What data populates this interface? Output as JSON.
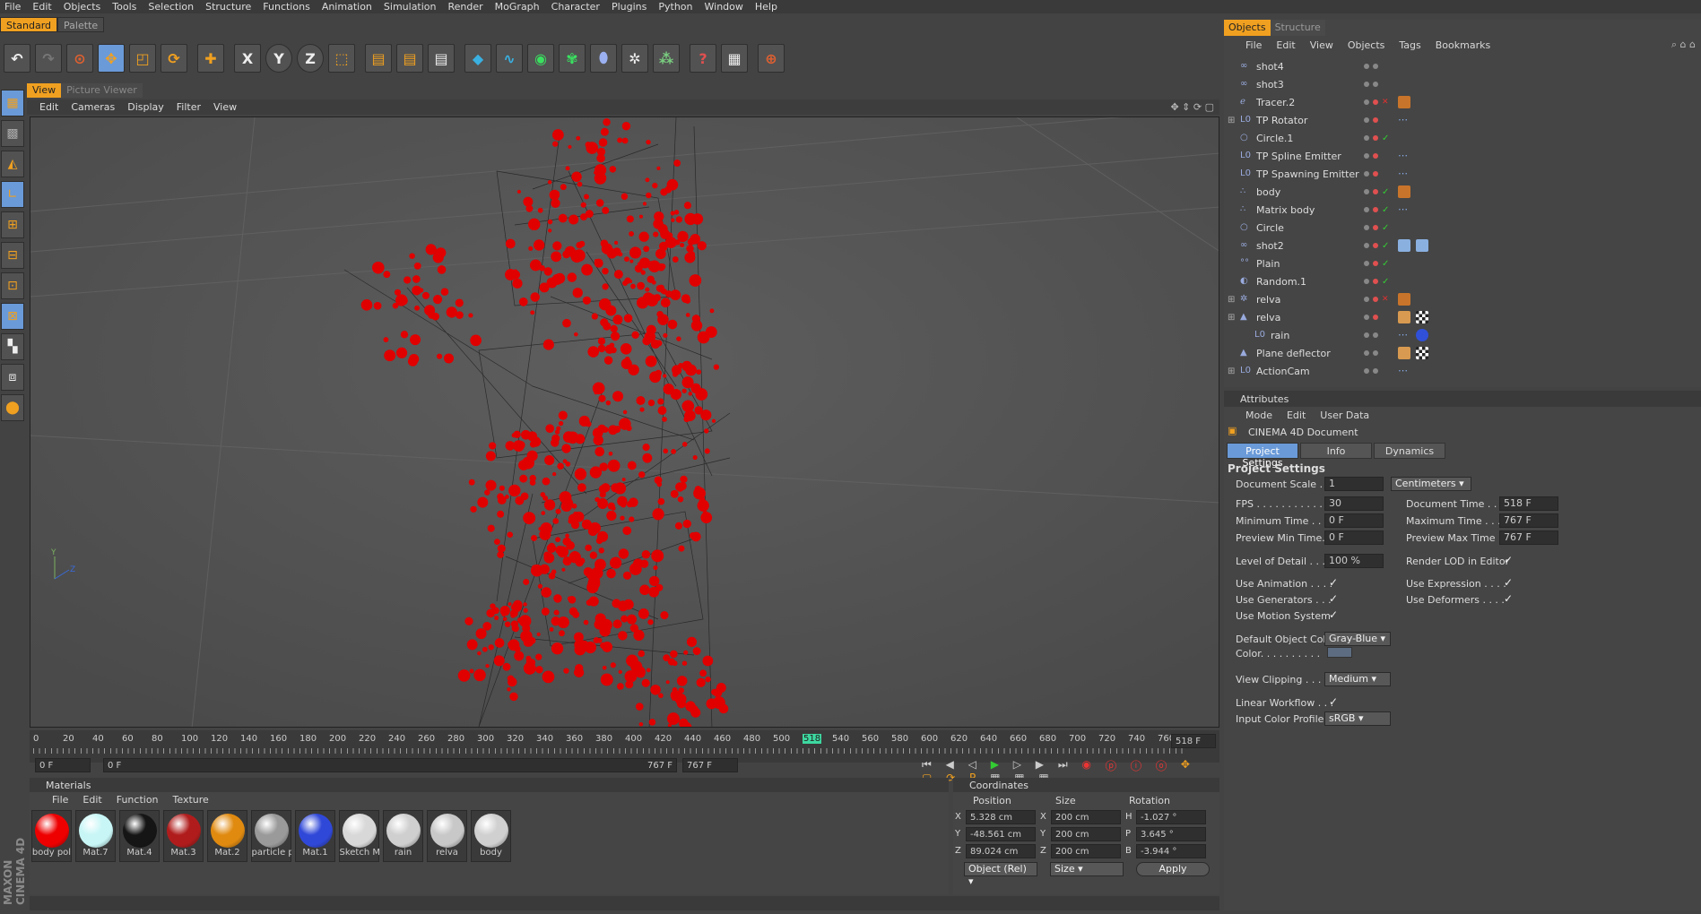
{
  "menubar": [
    "File",
    "Edit",
    "Objects",
    "Tools",
    "Selection",
    "Structure",
    "Functions",
    "Animation",
    "Simulation",
    "Render",
    "MoGraph",
    "Character",
    "Plugins",
    "Python",
    "Window",
    "Help"
  ],
  "layout_tabs": [
    "Standard",
    "Palette"
  ],
  "toolbar": {
    "x": "X",
    "y": "Y",
    "z": "Z"
  },
  "viewport": {
    "tabs": [
      "View",
      "Picture Viewer"
    ],
    "menu": [
      "Edit",
      "Cameras",
      "Display",
      "Filter",
      "View"
    ],
    "axis_y": "Y",
    "axis_z": "Z"
  },
  "timeline": {
    "ticks": [
      "0",
      "20",
      "40",
      "60",
      "80",
      "100",
      "120",
      "140",
      "160",
      "180",
      "200",
      "220",
      "240",
      "260",
      "280",
      "300",
      "320",
      "340",
      "360",
      "380",
      "400",
      "420",
      "440",
      "460",
      "480",
      "500",
      "518",
      "540",
      "560",
      "580",
      "600",
      "620",
      "640",
      "660",
      "680",
      "700",
      "720",
      "740",
      "760"
    ],
    "current_frame": "518 F",
    "start_field": "0 F",
    "range_start": "0 F",
    "range_end": "767 F",
    "end_field": "767 F"
  },
  "materials": {
    "title": "Materials",
    "menu": [
      "File",
      "Edit",
      "Function",
      "Texture"
    ],
    "items": [
      {
        "name": "body pol",
        "color": "#ee0000"
      },
      {
        "name": "Mat.7",
        "color": "#c8f6f6"
      },
      {
        "name": "Mat.4",
        "color": "#151515"
      },
      {
        "name": "Mat.3",
        "color": "#b01c1c"
      },
      {
        "name": "Mat.2",
        "color": "#e08a10"
      },
      {
        "name": "particle p",
        "color": "#9a9a9a"
      },
      {
        "name": "Mat.1",
        "color": "#3048d8"
      },
      {
        "name": "Sketch M",
        "color": "#d8d8d8"
      },
      {
        "name": "rain",
        "color": "#cfcfcf"
      },
      {
        "name": "relva",
        "color": "#c8c8c8"
      },
      {
        "name": "body",
        "color": "#d0d0d0"
      }
    ]
  },
  "coordinates": {
    "title": "Coordinates",
    "headers": [
      "Position",
      "Size",
      "Rotation"
    ],
    "rows": [
      {
        "pl": "X",
        "pos": "5.328 cm",
        "sl": "X",
        "size": "200 cm",
        "rl": "H",
        "rot": "-1.027 °"
      },
      {
        "pl": "Y",
        "pos": "-48.561 cm",
        "sl": "Y",
        "size": "200 cm",
        "rl": "P",
        "rot": "3.645 °"
      },
      {
        "pl": "Z",
        "pos": "89.024 cm",
        "sl": "Z",
        "size": "200 cm",
        "rl": "B",
        "rot": "-3.944 °"
      }
    ],
    "mode": "Object (Rel)",
    "size_mode": "Size",
    "apply": "Apply"
  },
  "brand": "MAXON CINEMA 4D",
  "objects_panel": {
    "tabs": [
      "Objects",
      "Structure"
    ],
    "menu": [
      "File",
      "Edit",
      "View",
      "Objects",
      "Tags",
      "Bookmarks"
    ],
    "items": [
      "shot4",
      "shot3",
      "Tracer.2",
      "TP Rotator",
      "Circle.1",
      "TP Spline Emitter",
      "TP Spawning Emitter",
      "body",
      "Matrix body",
      "Circle",
      "shot2",
      "Plain",
      "Random.1",
      "relva",
      "relva",
      "rain",
      "Plane deflector",
      "ActionCam"
    ]
  },
  "attributes": {
    "title": "Attributes",
    "menu": [
      "Mode",
      "Edit",
      "User Data"
    ],
    "doc_title": "CINEMA 4D Document",
    "tabs": [
      "Project Settings",
      "Info",
      "Dynamics"
    ],
    "section": "Project Settings",
    "document_scale_label": "Document Scale . .",
    "document_scale": "1",
    "units": "Centimeters",
    "fps_label": "FPS . . . . . . . . . . . .",
    "fps": "30",
    "doc_time_label": "Document Time . . . .",
    "doc_time": "518 F",
    "min_time_label": "Minimum Time . . . .",
    "min_time": "0 F",
    "max_time_label": "Maximum Time . . .",
    "max_time": "767 F",
    "prev_min_label": "Preview Min Time. .",
    "prev_min": "0 F",
    "prev_max_label": "Preview Max Time . .",
    "prev_max": "767 F",
    "lod_label": "Level of Detail . . . .",
    "lod": "100 %",
    "render_lod_label": "Render LOD in Editor",
    "use_animation": "Use Animation . . . .",
    "use_expression": "Use Expression . . . .",
    "use_generators": "Use Generators . . .",
    "use_deformers": "Use Deformers . . . .",
    "use_motion": "Use Motion System",
    "default_color_label": "Default Object Color",
    "default_color": "Gray-Blue",
    "color_label": "Color. . . . . . . . . .",
    "view_clipping_label": "View Clipping . . . . .",
    "view_clipping": "Medium",
    "linear_label": "Linear Workflow . . .",
    "input_profile_label": "Input Color Profile . .",
    "input_profile": "sRGB",
    "check": "✓"
  }
}
